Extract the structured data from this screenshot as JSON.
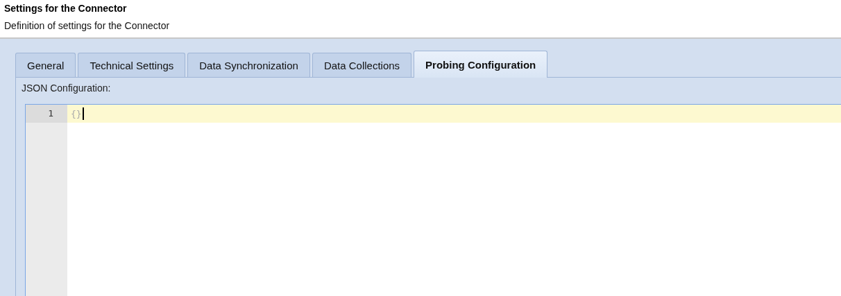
{
  "header": {
    "title": "Settings for the Connector",
    "subtitle": "Definition of settings for the Connector"
  },
  "tabs": [
    {
      "label": "General",
      "selected": false
    },
    {
      "label": "Technical Settings",
      "selected": false
    },
    {
      "label": "Data Synchronization",
      "selected": false
    },
    {
      "label": "Data Collections",
      "selected": false
    },
    {
      "label": "Probing Configuration",
      "selected": true
    }
  ],
  "field_label": "JSON Configuration:",
  "editor": {
    "lines": [
      {
        "number": "1",
        "text": "{}",
        "active": true
      }
    ]
  }
}
